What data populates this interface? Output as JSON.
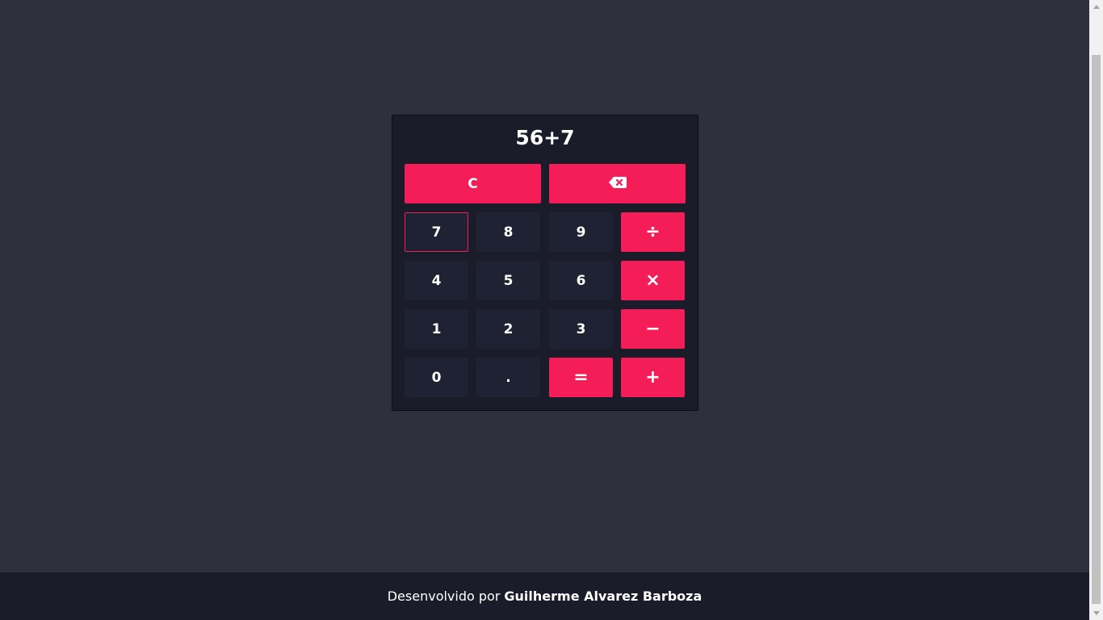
{
  "calculator": {
    "display": "56+7",
    "clear_label": "C",
    "backspace_icon": "backspace-icon",
    "keys": {
      "seven": "7",
      "eight": "8",
      "nine": "9",
      "divide": "÷",
      "four": "4",
      "five": "5",
      "six": "6",
      "multiply": "×",
      "one": "1",
      "two": "2",
      "three": "3",
      "minus": "−",
      "zero": "0",
      "dot": ".",
      "equals": "=",
      "plus": "+"
    }
  },
  "footer": {
    "prefix": "Desenvolvido por",
    "author": "Guilherme Alvarez Barboza"
  },
  "colors": {
    "background": "#2e303c",
    "panel": "#1b1c29",
    "key": "#1f2233",
    "accent": "#f41d58",
    "text": "#ffffff"
  }
}
